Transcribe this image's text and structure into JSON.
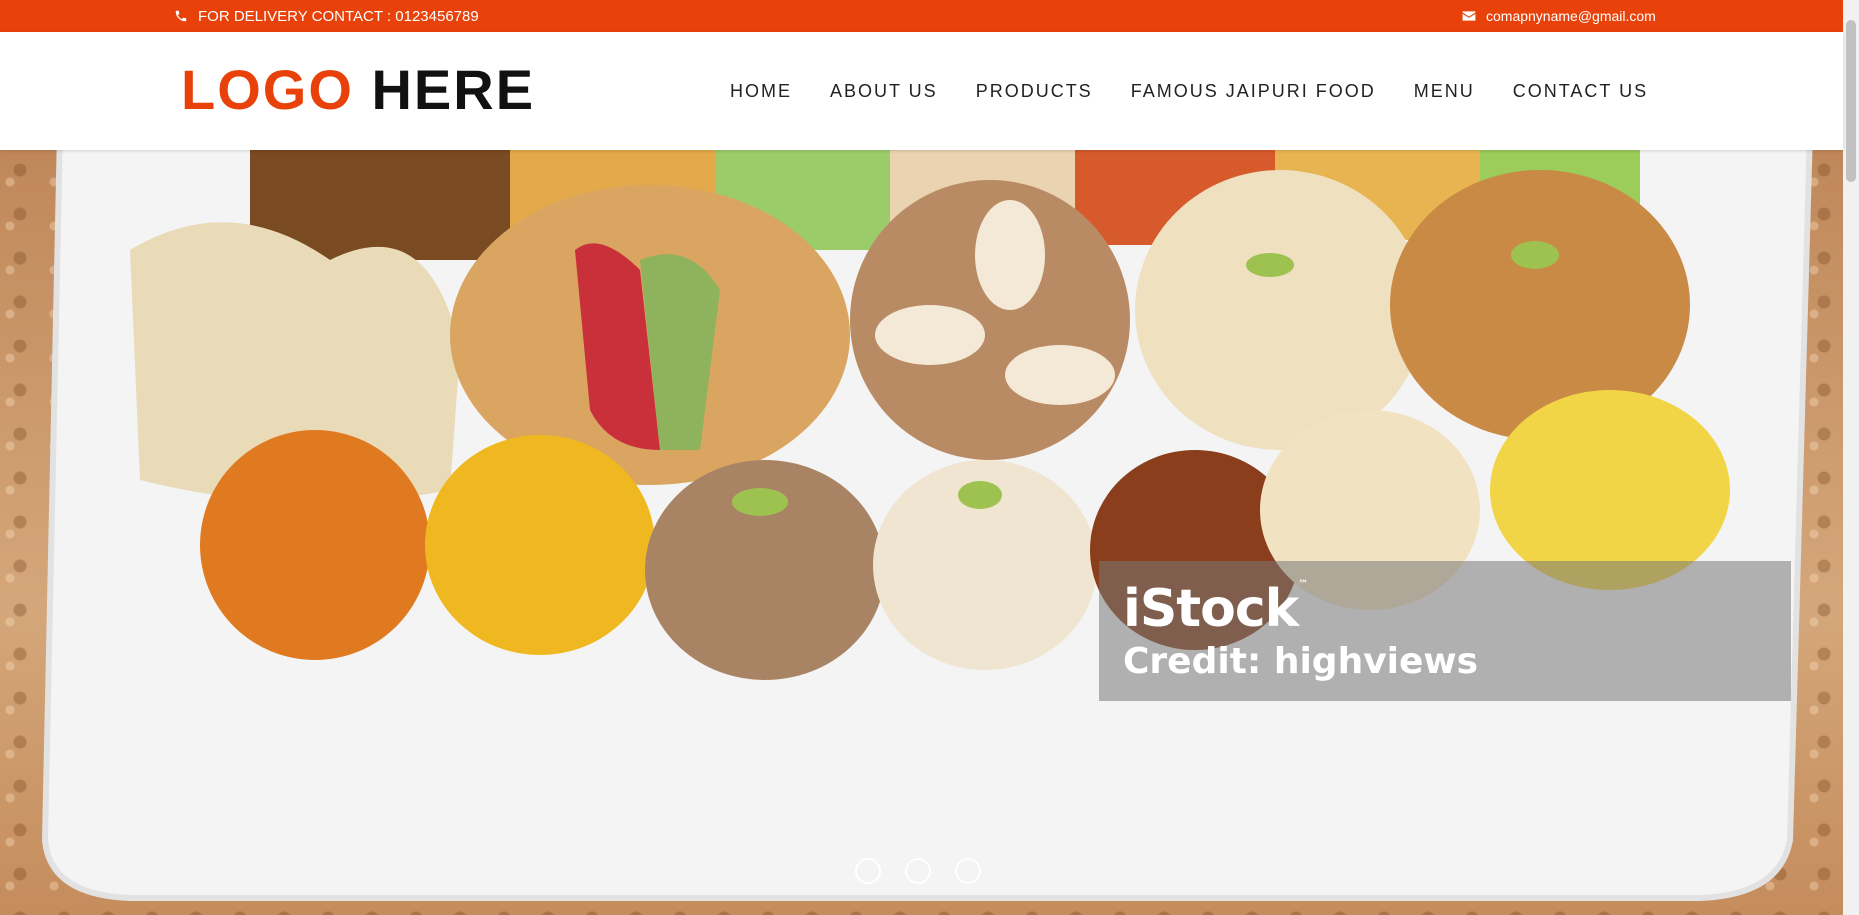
{
  "topbar": {
    "phone_text": "FOR DELIVERY CONTACT : 0123456789",
    "phone_icon": "phone-icon",
    "email_text": "comapnyname@gmail.com",
    "email_icon": "envelope-icon",
    "bg_color": "#e8420a"
  },
  "header": {
    "logo_part1": "LOGO",
    "logo_part2": "HERE",
    "accent_color": "#e8420a",
    "nav": [
      {
        "label": "HOME"
      },
      {
        "label": "ABOUT US"
      },
      {
        "label": "PRODUCTS"
      },
      {
        "label": "FAMOUS JAIPURI FOOD"
      },
      {
        "label": "MENU"
      },
      {
        "label": "CONTACT US"
      }
    ]
  },
  "hero": {
    "image_description_icon": "sweets-platter-image",
    "watermark_brand": "iStock",
    "watermark_tm": "™",
    "watermark_credit": "Credit: highviews",
    "slide_count": 3
  }
}
